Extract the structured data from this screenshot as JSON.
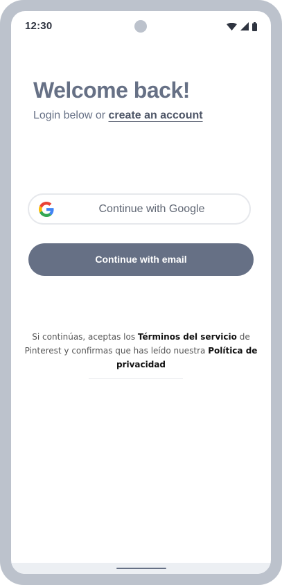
{
  "status_bar": {
    "time": "12:30",
    "icons": [
      "wifi-icon",
      "cellular-signal-icon",
      "battery-icon"
    ]
  },
  "login": {
    "title": "Welcome back!",
    "subtitle_prefix": "Login below or ",
    "create_account_link": "create an account"
  },
  "buttons": {
    "google_label": "Continue with Google",
    "google_icon": "google-g-icon",
    "email_label": "Continue with email"
  },
  "legal": {
    "text_1": "Si continúas, aceptas los ",
    "terms_link": "Términos del servicio",
    "text_2": " de Pinterest y confirmas que has leído nuestra ",
    "privacy_link": "Política de privacidad"
  },
  "colors": {
    "primary": "#667085",
    "device_frame": "#bcc2cc",
    "google_blue": "#4285F4",
    "google_red": "#EA4335",
    "google_yellow": "#FBBC05",
    "google_green": "#34A853"
  }
}
